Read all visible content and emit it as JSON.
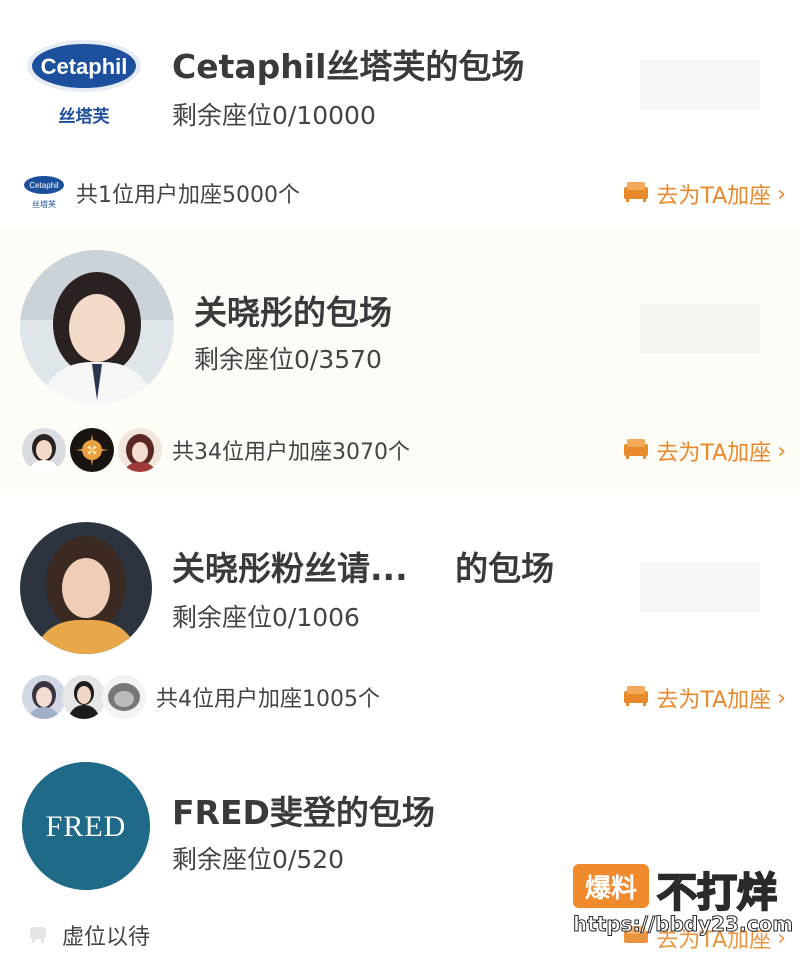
{
  "colors": {
    "accent": "#e8892c",
    "card_tint": "#fdfcf6",
    "fred_blue": "#1f6a88",
    "cetaphil_blue": "#1c4f9c"
  },
  "cards": [
    {
      "title": "Cetaphil丝塔芙的包场",
      "seats": "剩余座位0/10000",
      "users_text": "共1位用户加座5000个",
      "join_label": "去为TA加座",
      "logo": {
        "brand": "Cetaphil",
        "sub": "丝塔芙"
      },
      "mini_logo": {
        "brand": "Cetaphil",
        "sub": "丝塔芙"
      }
    },
    {
      "title": "关晓彤的包场",
      "seats": "剩余座位0/3570",
      "users_text": "共34位用户加座3070个",
      "join_label": "去为TA加座"
    },
    {
      "title": "关晓彤粉丝请...",
      "title_suffix": "的包场",
      "seats": "剩余座位0/1006",
      "users_text": "共4位用户加座1005个",
      "join_label": "去为TA加座"
    },
    {
      "title": "FRED斐登的包场",
      "seats": "剩余座位0/520",
      "users_text": "虚位以待",
      "join_label": "去为TA加座",
      "logo": {
        "brand": "FRED"
      }
    }
  ],
  "watermark": {
    "badge": "爆料",
    "text": "不打烊",
    "url": "https://bbdy23.com"
  },
  "icons": {
    "join": "sofa-icon",
    "chevron": "chevron-right-icon",
    "empty_seat": "seat-icon"
  }
}
